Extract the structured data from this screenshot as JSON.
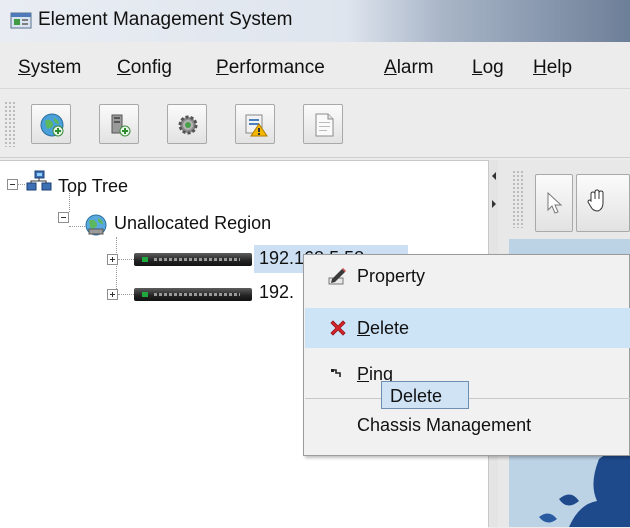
{
  "window": {
    "title": "Element Management System",
    "icon": "app-window-icon"
  },
  "menubar": {
    "items": [
      {
        "pre": "",
        "mn": "S",
        "post": "ystem"
      },
      {
        "pre": "",
        "mn": "C",
        "post": "onfig"
      },
      {
        "pre": "",
        "mn": "P",
        "post": "erformance"
      },
      {
        "pre": "",
        "mn": "A",
        "post": "larm"
      },
      {
        "pre": "",
        "mn": "L",
        "post": "og"
      },
      {
        "pre": "",
        "mn": "H",
        "post": "elp"
      }
    ]
  },
  "toolbar": {
    "buttons": [
      {
        "icon": "globe-add-icon"
      },
      {
        "icon": "device-add-icon"
      },
      {
        "icon": "gear-icon"
      },
      {
        "icon": "warning-alarm-icon"
      },
      {
        "icon": "document-icon"
      }
    ]
  },
  "tree": {
    "root": {
      "label": "Top Tree",
      "icon": "topology-network-icon"
    },
    "region": {
      "label": "Unallocated Region",
      "icon": "globe-region-icon"
    },
    "devices": [
      {
        "label": "192.168.5.58",
        "selected": true
      },
      {
        "label": "192.",
        "selected": false
      }
    ]
  },
  "context_menu": {
    "items": [
      {
        "pre": "",
        "mn": "",
        "post": "Property",
        "icon": "property-pencil-icon"
      },
      {
        "pre": "",
        "mn": "D",
        "post": "elete",
        "icon": "delete-x-icon",
        "highlighted": true
      },
      {
        "pre": "",
        "mn": "P",
        "post": "ing",
        "icon": "ping-icon"
      },
      {
        "pre": "",
        "mn": "",
        "post": "Chassis Management",
        "icon": ""
      }
    ],
    "tooltip": "Delete"
  },
  "colors": {
    "menu_highlight": "#cde3f6",
    "selection": "#cde0f3",
    "delete_red": "#d8252b"
  }
}
